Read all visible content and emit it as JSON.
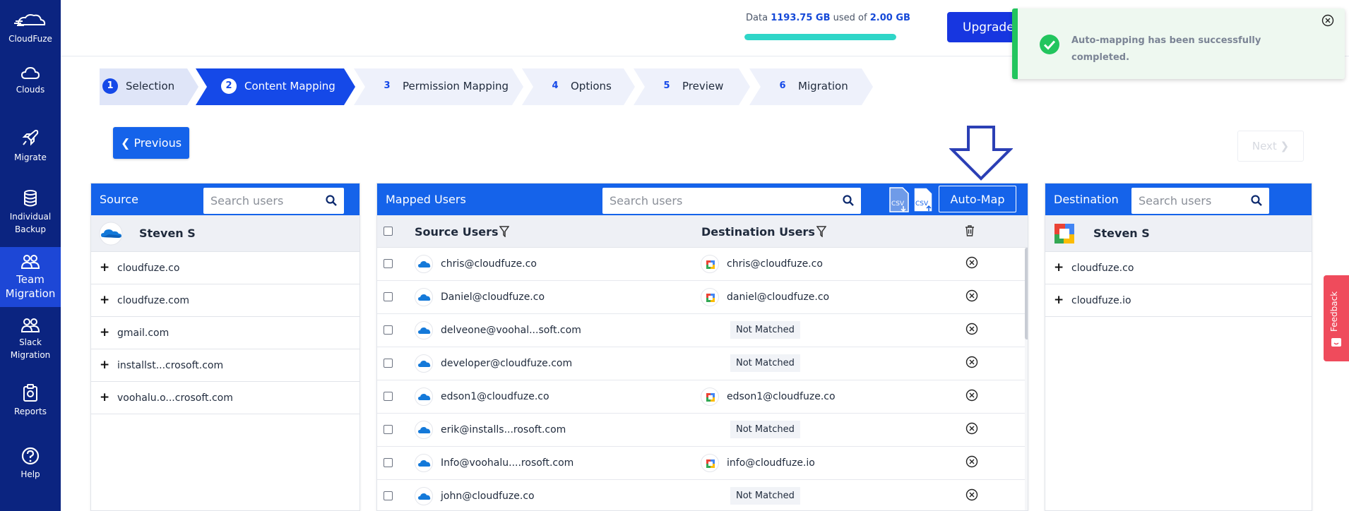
{
  "app": {
    "brand": "CloudFuze"
  },
  "sidebar": {
    "items": [
      {
        "label": "Clouds",
        "icon": "cloud-icon"
      },
      {
        "label": "Migrate",
        "icon": "rocket-icon"
      },
      {
        "label": "Individual Backup",
        "line1": "Individual",
        "line2": "Backup",
        "icon": "database-icon"
      },
      {
        "label": "Team Migration",
        "line1": "Team",
        "line2": "Migration",
        "icon": "team-icon"
      },
      {
        "label": "Slack Migration",
        "line1": "Slack",
        "line2": "Migration",
        "icon": "users-icon"
      },
      {
        "label": "Reports",
        "icon": "clipboard-icon"
      },
      {
        "label": "Help",
        "icon": "help-icon"
      }
    ]
  },
  "usage": {
    "prefix": "Data ",
    "used": "1193.75 GB",
    "middle": " used of ",
    "total": "2.00 GB",
    "fill_fraction": 1.0
  },
  "header": {
    "upgrade_label": "Upgrade"
  },
  "toast": {
    "message": "Auto-mapping has been successfully completed."
  },
  "steps": [
    {
      "num": "1",
      "label": "Selection",
      "state": "done"
    },
    {
      "num": "2",
      "label": "Content Mapping",
      "state": "active"
    },
    {
      "num": "3",
      "label": "Permission Mapping",
      "state": "todo"
    },
    {
      "num": "4",
      "label": "Options",
      "state": "todo"
    },
    {
      "num": "5",
      "label": "Preview",
      "state": "todo"
    },
    {
      "num": "6",
      "label": "Migration",
      "state": "todo"
    }
  ],
  "nav": {
    "previous_label": "Previous",
    "next_label": "Next"
  },
  "source": {
    "title": "Source",
    "search_placeholder": "Search users",
    "account": "Steven S",
    "domains": [
      "cloudfuze.co",
      "cloudfuze.com",
      "gmail.com",
      "installst...crosoft.com",
      "voohalu.o...crosoft.com"
    ]
  },
  "mapped": {
    "title": "Mapped Users",
    "search_placeholder": "Search users",
    "automap_label": "Auto-Map",
    "csv_label": "CSV",
    "col_source": "Source Users",
    "col_destination": "Destination Users",
    "not_matched": "Not Matched",
    "rows": [
      {
        "source": "chris@cloudfuze.co",
        "destination": "chris@cloudfuze.co",
        "matched": true
      },
      {
        "source": "Daniel@cloudfuze.co",
        "destination": "daniel@cloudfuze.co",
        "matched": true
      },
      {
        "source": "delveone@voohal...soft.com",
        "destination": "",
        "matched": false
      },
      {
        "source": "developer@cloudfuze.com",
        "destination": "",
        "matched": false
      },
      {
        "source": "edson1@cloudfuze.co",
        "destination": "edson1@cloudfuze.co",
        "matched": true
      },
      {
        "source": "erik@installs...rosoft.com",
        "destination": "",
        "matched": false
      },
      {
        "source": "Info@voohalu....rosoft.com",
        "destination": "info@cloudfuze.io",
        "matched": true
      },
      {
        "source": "john@cloudfuze.co",
        "destination": "",
        "matched": false
      }
    ]
  },
  "destination": {
    "title": "Destination",
    "search_placeholder": "Search users",
    "account": "Steven S",
    "domains": [
      "cloudfuze.co",
      "cloudfuze.io"
    ]
  },
  "feedback": {
    "label": "Feedback"
  },
  "colors": {
    "sidebar": "#0b2480",
    "primary": "#1563ea",
    "success": "#22c55e",
    "usage_fill": "#2fd6c8",
    "feedback": "#ef4b5c"
  }
}
